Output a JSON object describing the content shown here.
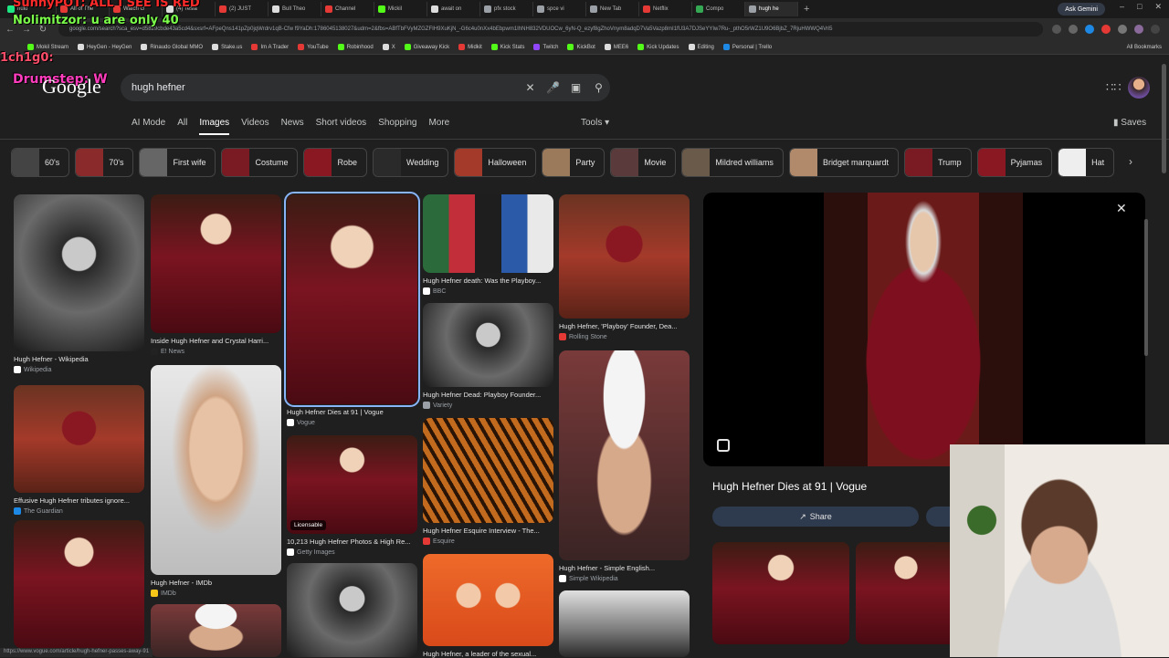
{
  "browser": {
    "tabs": [
      {
        "label": "hulu",
        "color": "#1ce783"
      },
      {
        "label": "All of The",
        "color": "#e53935"
      },
      {
        "label": "Watch G",
        "color": "#e53935"
      },
      {
        "label": "(4) Tesla",
        "color": "#dddddd"
      },
      {
        "label": "(2) JUST",
        "color": "#e53935"
      },
      {
        "label": "Bull Theo",
        "color": "#dddddd"
      },
      {
        "label": "Channel",
        "color": "#e53935"
      },
      {
        "label": "Mickil",
        "color": "#53fc18"
      },
      {
        "label": "await on",
        "color": "#dddddd"
      },
      {
        "label": "pfx stock",
        "color": "#9aa0a6"
      },
      {
        "label": "spce vi",
        "color": "#9aa0a6"
      },
      {
        "label": "New Tab",
        "color": "#9aa0a6"
      },
      {
        "label": "Netflix",
        "color": "#e53935"
      },
      {
        "label": "Compo",
        "color": "#34a853"
      },
      {
        "label": "hugh he",
        "color": "#9aa0a6",
        "active": true
      }
    ],
    "new_tab": "+",
    "ask_gemini": "Ask Gemini",
    "url": "google.com/search?sca_esv=d5829cbde43a5cd4&sxsrf=AFpeQns141pZp0jqWrdrv1qB-Cfw f9YaDh:1786045138027&udm=2&fbs=ABfTbFVyMZGZFIH9XuKjN_-G6c4u0nXx4bEbpwm1IhNH832VDUOCw_6yN-Q_ezyf8gZhoVnym8adqD7Va5Vazp8mI1fU3A7DJSeYYIw7Ru-_pthO5rWZ1U9O6BjbZ_7RjuHWWQ4Vri5",
    "bookmarks": [
      {
        "label": "Mokil Stream",
        "color": "#53fc18"
      },
      {
        "label": "HeyGen - HeyGen",
        "color": "#dddddd"
      },
      {
        "label": "Rinaudo Global MMO",
        "color": "#dddddd"
      },
      {
        "label": "Stake.us",
        "color": "#dddddd"
      },
      {
        "label": "Im A Trader",
        "color": "#e53935"
      },
      {
        "label": "YouTube",
        "color": "#e53935"
      },
      {
        "label": "Robinhood",
        "color": "#53fc18"
      },
      {
        "label": "X",
        "color": "#dddddd"
      },
      {
        "label": "Giveaway Kick",
        "color": "#53fc18"
      },
      {
        "label": "Midkit",
        "color": "#e53935"
      },
      {
        "label": "Kick Stats",
        "color": "#53fc18"
      },
      {
        "label": "Twitch",
        "color": "#9146ff"
      },
      {
        "label": "KickBot",
        "color": "#53fc18"
      },
      {
        "label": "MEE6",
        "color": "#dddddd"
      },
      {
        "label": "Kick Updates",
        "color": "#53fc18"
      },
      {
        "label": "Editing",
        "color": "#dddddd"
      },
      {
        "label": "Personal | Trello",
        "color": "#1e88e5"
      }
    ],
    "all_bookmarks": "All Bookmarks"
  },
  "overlay": {
    "line1": "SunnyPOT: ALL I SEE IS RED",
    "line2": "Nolimitzor: u are only 40",
    "line3": "1ch1g0:",
    "line4": "Drumstep: W"
  },
  "google": {
    "logo": "Google",
    "query": "hugh hefner",
    "filters": [
      "AI Mode",
      "All",
      "Images",
      "Videos",
      "News",
      "Short videos",
      "Shopping",
      "More"
    ],
    "active_filter": "Images",
    "tools": "Tools",
    "saves": "Saves",
    "chips": [
      {
        "label": "60's",
        "thumb": "#444444"
      },
      {
        "label": "70's",
        "thumb": "#8a2a2a"
      },
      {
        "label": "First wife",
        "thumb": "#666666"
      },
      {
        "label": "Costume",
        "thumb": "#7a1a22"
      },
      {
        "label": "Robe",
        "thumb": "#8a1822"
      },
      {
        "label": "Wedding",
        "thumb": "#2a2a2a"
      },
      {
        "label": "Halloween",
        "thumb": "#a33a2a"
      },
      {
        "label": "Party",
        "thumb": "#9a7a5a"
      },
      {
        "label": "Movie",
        "thumb": "#5a3a3a"
      },
      {
        "label": "Mildred williams",
        "thumb": "#6a5a4a"
      },
      {
        "label": "Bridget marquardt",
        "thumb": "#b08a6a"
      },
      {
        "label": "Trump",
        "thumb": "#7a1a22"
      },
      {
        "label": "Pyjamas",
        "thumb": "#8a1822"
      },
      {
        "label": "Hat",
        "thumb": "#eeeeee"
      }
    ],
    "results": [
      {
        "caption": "Hugh Hefner - Wikipedia",
        "source": "Wikipedia",
        "src_color": "#ffffff"
      },
      {
        "caption": "Effusive Hugh Hefner tributes ignore...",
        "source": "The Guardian",
        "src_color": "#1e88e5"
      },
      {
        "caption": "",
        "source": "",
        "src_color": ""
      },
      {
        "caption": "Inside Hugh Hefner and Crystal Harri...",
        "source": "E! News",
        "src_color": "#222222"
      },
      {
        "caption": "Hugh Hefner - IMDb",
        "source": "IMDb",
        "src_color": "#f5c518"
      },
      {
        "caption": "",
        "source": "",
        "src_color": ""
      },
      {
        "caption": "Hugh Hefner Dies at 91 | Vogue",
        "source": "Vogue",
        "src_color": "#ffffff"
      },
      {
        "caption": "10,213 Hugh Hefner Photos & High Re...",
        "source": "Getty Images",
        "src_color": "#ffffff",
        "badge": "Licensable"
      },
      {
        "caption": "",
        "source": "",
        "src_color": ""
      },
      {
        "caption": "Hugh Hefner death: Was the Playboy...",
        "source": "BBC",
        "src_color": "#ffffff"
      },
      {
        "caption": "Hugh Hefner Dead: Playboy Founder...",
        "source": "Variety",
        "src_color": "#9aa0a6"
      },
      {
        "caption": "Hugh Hefner Esquire Interview - The...",
        "source": "Esquire",
        "src_color": "#e53935"
      },
      {
        "caption": "Hugh Hefner, a leader of the sexual...",
        "source": "",
        "src_color": ""
      },
      {
        "caption": "Hugh Hefner, 'Playboy' Founder, Dea...",
        "source": "Rolling Stone",
        "src_color": "#e53935"
      },
      {
        "caption": "Hugh Hefner - Simple English...",
        "source": "Simple Wikipedia",
        "src_color": "#ffffff"
      },
      {
        "caption": "",
        "source": "",
        "src_color": ""
      }
    ],
    "preview": {
      "title": "Hugh Hefner Dies at 91 | Vogue",
      "share": "Share"
    },
    "status_url": "https://www.vogue.com/article/hugh-hefner-passes-away-91"
  }
}
